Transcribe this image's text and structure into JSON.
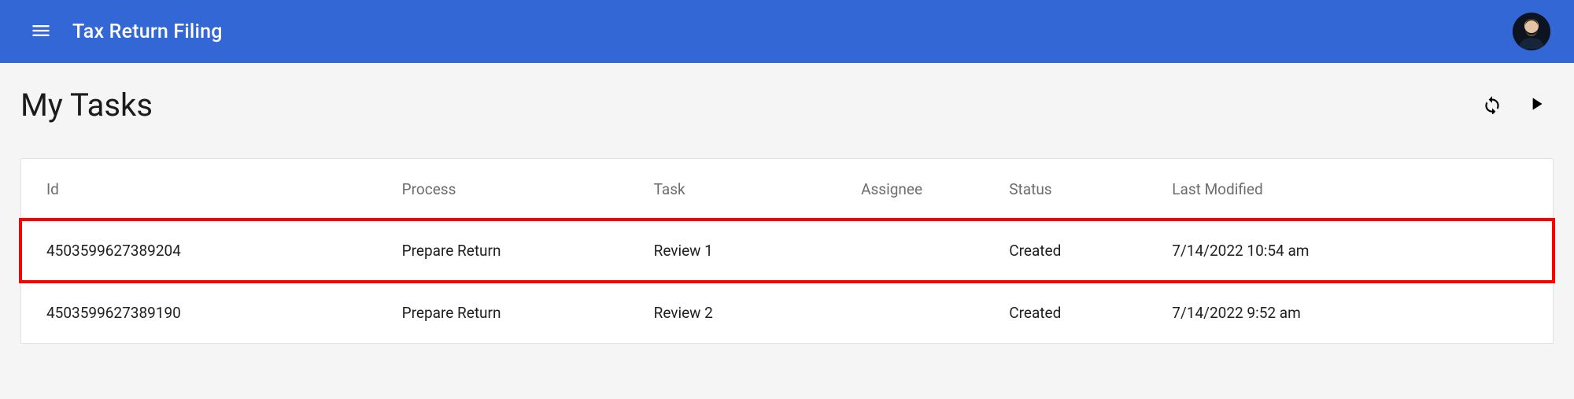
{
  "header": {
    "app_title": "Tax Return Filing"
  },
  "page": {
    "title": "My Tasks"
  },
  "table": {
    "columns": {
      "id": "Id",
      "process": "Process",
      "task": "Task",
      "assignee": "Assignee",
      "status": "Status",
      "last_modified": "Last Modified"
    },
    "rows": [
      {
        "id": "4503599627389204",
        "process": "Prepare Return",
        "task": "Review 1",
        "assignee": "",
        "status": "Created",
        "last_modified": "7/14/2022 10:54 am",
        "highlighted": true
      },
      {
        "id": "4503599627389190",
        "process": "Prepare Return",
        "task": "Review 2",
        "assignee": "",
        "status": "Created",
        "last_modified": "7/14/2022 9:52 am",
        "highlighted": false
      }
    ]
  }
}
